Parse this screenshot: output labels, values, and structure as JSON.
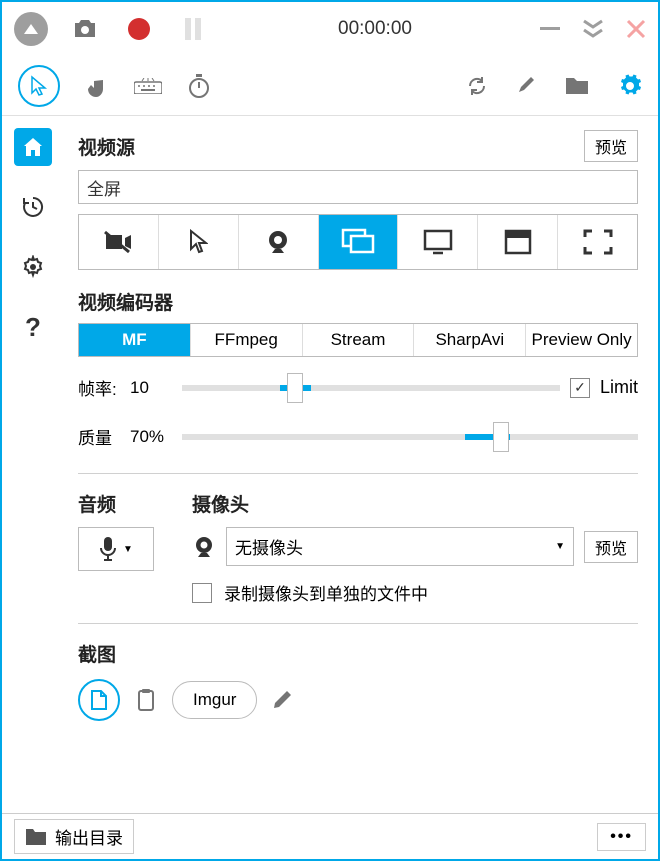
{
  "titlebar": {
    "timer": "00:00:00"
  },
  "sections": {
    "video_source": {
      "title": "视频源",
      "preview": "预览",
      "value": "全屏"
    },
    "encoder": {
      "title": "视频编码器",
      "tabs": [
        "MF",
        "FFmpeg",
        "Stream",
        "SharpAvi",
        "Preview Only"
      ],
      "fps_label": "帧率:",
      "fps_value": "10",
      "limit_label": "Limit",
      "limit_checked": "✓",
      "quality_label": "质量",
      "quality_value": "70%"
    },
    "audio": {
      "title": "音频"
    },
    "camera": {
      "title": "摄像头",
      "select_value": "无摄像头",
      "preview": "预览",
      "record_separate": "录制摄像头到单独的文件中"
    },
    "screenshot": {
      "title": "截图",
      "imgur": "Imgur"
    }
  },
  "statusbar": {
    "output": "输出目录",
    "more": "•••"
  }
}
